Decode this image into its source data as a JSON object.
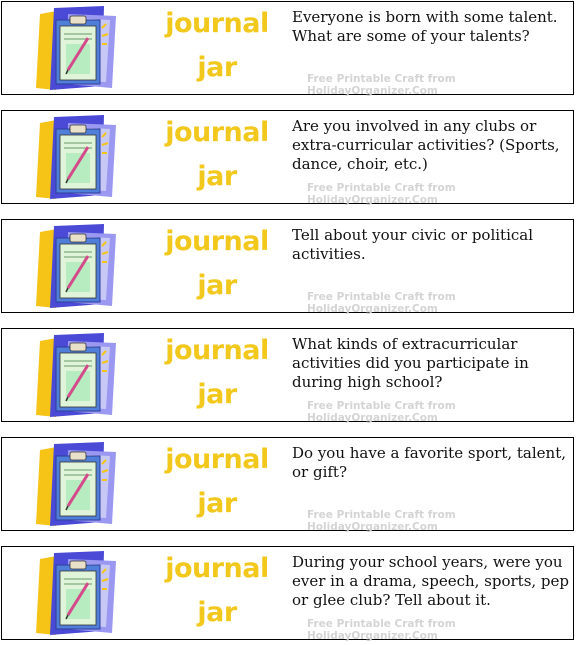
{
  "cards": [
    {
      "title_line1": "journal",
      "title_line2": "jar",
      "prompt": "Everyone is born with some talent. What are some of your talents?",
      "credit": "Free Printable Craft from HolidayOrganizer.Com"
    },
    {
      "title_line1": "journal",
      "title_line2": "jar",
      "prompt": "Are you involved in any clubs or extra-curricular activities? (Sports, dance, choir, etc.)",
      "credit": "Free Printable Craft from HolidayOrganizer.Com"
    },
    {
      "title_line1": "journal",
      "title_line2": "jar",
      "prompt": "Tell about your civic or political activities.",
      "credit": "Free Printable Craft from HolidayOrganizer.Com"
    },
    {
      "title_line1": "journal",
      "title_line2": "jar",
      "prompt": "What kinds of extracurricular activities did you participate in during high school?",
      "credit": "Free Printable Craft from HolidayOrganizer.Com"
    },
    {
      "title_line1": "journal",
      "title_line2": "jar",
      "prompt": "Do you have a favorite sport, talent,  or gift?",
      "credit": "Free Printable Craft from HolidayOrganizer.Com"
    },
    {
      "title_line1": "journal",
      "title_line2": "jar",
      "prompt": "During your school years, were you ever in a drama, speech, sports, pep or glee club? Tell about it.",
      "credit": "Free Printable Craft from HolidayOrganizer.Com"
    }
  ],
  "colors": {
    "title": "#f2c81c",
    "credit": "#d4d4d4",
    "border": "#000000"
  },
  "icon": "clipboard-clipart-icon"
}
